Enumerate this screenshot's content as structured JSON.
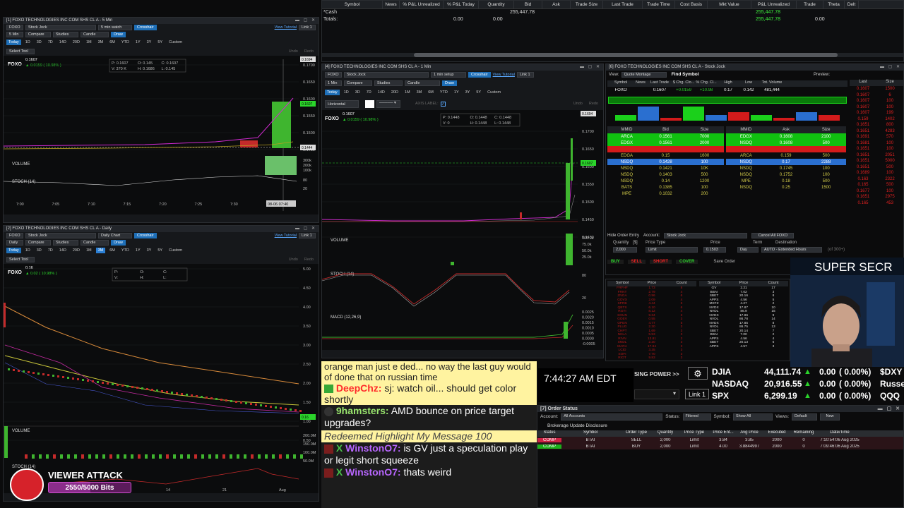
{
  "portfolio": {
    "columns": [
      "Symbol",
      "News",
      "% P&L Unrealized",
      "% P&L Today",
      "Quantity",
      "Bid",
      "Ask",
      "Trade Size",
      "Last Trade",
      "Trade Time",
      "Cost Basis",
      "Mkt Value",
      "P&L Unrealized",
      "Trade",
      "Theta",
      "Delt"
    ],
    "cash_label": "*Cash",
    "totals_label": "Totals:",
    "cash_quantity": "255,447.78",
    "cash_mkt_value": "255,447.78",
    "totals_unreal": "0.00",
    "totals_today": "0.00",
    "totals_mkt_value": "255,447.78",
    "totals_pl": "0.00"
  },
  "chart1": {
    "title": "[1] FOXO TECHNOLOGIES INC COM SHS CL A - 5 Min",
    "symbol": "FOXO",
    "layout": "Stock Jock",
    "setup": "5 min watch",
    "interval": "5 Min",
    "crosshair": "Crosshair",
    "tutorial": "View Tutorial",
    "link": "Link 1",
    "compare": "Compare",
    "studies": "Studies",
    "candle": "Candle",
    "draw": "Draw",
    "timeframes": [
      "Today",
      "1D",
      "3D",
      "7D",
      "14D",
      "20D",
      "1M",
      "3M",
      "6M",
      "YTD",
      "1Y",
      "3Y",
      "5Y",
      "Custom"
    ],
    "select_tool": "Select Tool",
    "undo": "Undo",
    "redo": "Redo",
    "price": "0.1607",
    "change": "0.0159 ( 10.98% )",
    "ohlc_p": "P: 0.1607",
    "ohlc_o": "O: 0.145",
    "ohlc_c": "C: 0.1607",
    "ohlc_v": "V: 370 K",
    "ohlc_h": "H: 0.1686",
    "ohlc_l": "L: 0.145",
    "volume_label": "VOLUME",
    "stoch_label": "STOCH (14)",
    "time_labels": [
      "7:00",
      "7:05",
      "7:10",
      "7:15",
      "7:20",
      "7:25",
      "7:30",
      "7:35"
    ],
    "current_time": "08-06 07:40",
    "y_labels": [
      "0.1700",
      "0.1650",
      "0.1600",
      "0.1550",
      "0.1500",
      "0.1450"
    ],
    "badge_price": "0.1607",
    "badge_top": "0.1694",
    "badge_low": "0.1444",
    "vol_labels": [
      "300k",
      "200k",
      "100k"
    ],
    "stoch_labels": [
      "80",
      "20"
    ]
  },
  "chart2": {
    "title": "[2] FOXO TECHNOLOGIES INC COM SHS CL A - Daily",
    "setup": "Daily Chart",
    "interval": "Daily",
    "symbol": "FOXO",
    "price": "0.16",
    "change": "0.02 ( 10.98% )",
    "ohlc_p": "P:",
    "ohlc_o": "O:",
    "ohlc_c": "C:",
    "ohlc_v": "V:",
    "ohlc_h": "H:",
    "ohlc_l": "L:",
    "volume_label": "VOLUME",
    "stoch_label": "STOCH (14)",
    "y_labels": [
      "5.00",
      "4.50",
      "4.00",
      "3.50",
      "3.00",
      "2.50",
      "2.00",
      "1.50",
      "1.00",
      "0.50"
    ],
    "vol_labels": [
      "200.0M",
      "150.0M",
      "100.0M",
      "50.0M"
    ],
    "time_labels": [
      "Jul",
      "14",
      "21",
      "Aug"
    ],
    "badge_price": "0.16"
  },
  "chart3": {
    "title": "[4] FOXO TECHNOLOGIES INC COM SHS CL A - 1 Min",
    "setup": "1 min setup",
    "interval": "1 Min",
    "horizontal": "Horizontal",
    "axis_label": "AXIS LABEL:",
    "price": "0.1607",
    "change": "0.0159 ( 10.98% )",
    "ohlc_p": "P: 0.1448",
    "ohlc_o": "O: 0.1448",
    "ohlc_c": "C: 0.1448",
    "ohlc_v": "V: 0",
    "ohlc_h": "H: 0.1448",
    "ohlc_l": "L: 0.1448",
    "volume_label": "VOLUME",
    "stoch_label": "STOCH (14)",
    "macd_label": "MACD (12,26,9)",
    "y_labels": [
      "0.1700",
      "0.1650",
      "0.1600",
      "0.1550",
      "0.1500",
      "0.1450",
      "0.1400"
    ],
    "vol_labels": [
      "100.0k",
      "75.0k",
      "50.0k",
      "25.0k"
    ],
    "stoch_labels": [
      "80",
      "20"
    ],
    "macd_labels": [
      "0.0025",
      "0.0020",
      "0.0015",
      "0.0010",
      "0.0005",
      "0.0000",
      "-0.0005"
    ],
    "badge_price": "0.1607",
    "badge_top": "0.1694"
  },
  "level2": {
    "title": "[6] FOXO TECHNOLOGIES INC COM SHS CL A - Stock Jock",
    "view_label": "View:",
    "view_value": "Quote Montage",
    "find_symbol": "Find Symbol",
    "preview_label": "Preview:",
    "preview_value": "OFF",
    "quote_headers": [
      "Symbol",
      "News",
      "Last Trade",
      "$ Chg. Clo...",
      "% Chg. Cl...",
      "High",
      "Low",
      "Tot. Volume"
    ],
    "quote_values": [
      "FOXO",
      "",
      "0.1607",
      "+0.0159",
      "+10.98",
      "0.17",
      "0.142",
      "481,444"
    ],
    "bid_headers": [
      "MMID",
      "Bid",
      "Size"
    ],
    "ask_headers": [
      "MMID",
      "Ask",
      "Size"
    ],
    "bids": [
      {
        "mmid": "ARCA",
        "price": "0.1561",
        "size": "7000",
        "c": "#10c010"
      },
      {
        "mmid": "EDGX",
        "price": "0.1561",
        "size": "2000",
        "c": "#10c010"
      },
      {
        "mmid": "",
        "price": "",
        "size": "",
        "c": "#d31b1b"
      },
      {
        "mmid": "EDGA",
        "price": "0.15",
        "size": "1600",
        "c": "#0b0b0c"
      },
      {
        "mmid": "NSDQ",
        "price": "0.1428",
        "size": "100",
        "c": "#2a6fd0"
      },
      {
        "mmid": "NSDQ",
        "price": "0.1421",
        "size": "10K",
        "c": "#0b0b0c"
      },
      {
        "mmid": "NSDQ",
        "price": "0.1403",
        "size": "500",
        "c": "#0b0b0c"
      },
      {
        "mmid": "NSDQ",
        "price": "0.14",
        "size": "1200",
        "c": "#0b0b0c"
      },
      {
        "mmid": "BATS",
        "price": "0.1385",
        "size": "100",
        "c": "#0b0b0c"
      },
      {
        "mmid": "MPE",
        "price": "0.1032",
        "size": "200",
        "c": "#0b0b0c"
      }
    ],
    "asks": [
      {
        "mmid": "EDGX",
        "price": "0.1608",
        "size": "2100",
        "c": "#10c010"
      },
      {
        "mmid": "NSDQ",
        "price": "0.1608",
        "size": "500",
        "c": "#10c010"
      },
      {
        "mmid": "",
        "price": "",
        "size": "",
        "c": "#d31b1b"
      },
      {
        "mmid": "ARCA",
        "price": "0.159",
        "size": "500",
        "c": "#0b0b0c"
      },
      {
        "mmid": "NSDQ",
        "price": "0.17",
        "size": "2288",
        "c": "#2a6fd0"
      },
      {
        "mmid": "NSDQ",
        "price": "0.1745",
        "size": "100",
        "c": "#0b0b0c"
      },
      {
        "mmid": "NSDQ",
        "price": "0.1752",
        "size": "100",
        "c": "#0b0b0c"
      },
      {
        "mmid": "MPE",
        "price": "0.18",
        "size": "500",
        "c": "#0b0b0c"
      },
      {
        "mmid": "NSDQ",
        "price": "0.25",
        "size": "1500",
        "c": "#0b0b0c"
      }
    ],
    "ts_headers": [
      "Last",
      "Size"
    ],
    "time_sales": [
      [
        "0.1607",
        "1500"
      ],
      [
        "0.1607",
        "6"
      ],
      [
        "0.1607",
        "100"
      ],
      [
        "0.1607",
        "100"
      ],
      [
        "0.1607",
        "199"
      ],
      [
        "0.159",
        "1402"
      ],
      [
        "0.1651",
        "800"
      ],
      [
        "0.1651",
        "4283"
      ],
      [
        "0.1691",
        "570"
      ],
      [
        "0.1681",
        "100"
      ],
      [
        "0.1651",
        "100"
      ],
      [
        "0.1651",
        "2051"
      ],
      [
        "0.1651",
        "5000"
      ],
      [
        "0.1651",
        "500"
      ],
      [
        "0.1689",
        "100"
      ],
      [
        "0.163",
        "2322"
      ],
      [
        "0.165",
        "500"
      ],
      [
        "0.1677",
        "100"
      ],
      [
        "0.1651",
        "2975"
      ],
      [
        "0.165",
        "453"
      ]
    ],
    "hide_order_entry": "Hide Order Entry",
    "account_label": "Account:",
    "account_value": "Stock Jock",
    "cancel_all": "Cancel All FOXO",
    "qty_label": "Quantity",
    "qty_unit": "[$]",
    "qty_value": "2,000",
    "price_type_label": "Price Type",
    "price_type_value": "Limit",
    "price_label": "Price",
    "price_value": "0.1503",
    "term_label": "Term",
    "term_value": "Day",
    "dest_label": "Destination",
    "dest_value": "AUTO - Extended Hours",
    "aon": "AON",
    "of_label": "(of 300+)",
    "buy": "BUY",
    "sell": "SELL",
    "short": "SHORT",
    "cover": "COVER",
    "save_order": "Save Order",
    "reserve": "Reserve"
  },
  "scanner": {
    "left_headers": [
      "Symbol",
      "Price",
      "Count"
    ],
    "left_rows": [
      [
        "FRFHF",
        "1.73",
        "8"
      ],
      [
        "FRNT",
        "2.79",
        "4"
      ],
      [
        "ZNGA",
        "0.96",
        "6"
      ],
      [
        "GOVX",
        "2.09",
        "4"
      ],
      [
        "SPRB",
        "4.44",
        "6"
      ],
      [
        "QBTS",
        "6.10",
        "6"
      ],
      [
        "RGTI",
        "8.12",
        "4"
      ],
      [
        "SOUN",
        "9.34",
        "3"
      ],
      [
        "GOEV",
        "0.55",
        "3"
      ],
      [
        "OPEN",
        "4.77",
        "5"
      ],
      [
        "PLUG",
        "2.30",
        "3"
      ],
      [
        "CHPT",
        "1.69",
        "3"
      ],
      [
        "NKLA",
        "5.53",
        "3"
      ],
      [
        "RIVN",
        "13.81",
        "3"
      ],
      [
        "SNDL",
        "2.20",
        "3"
      ],
      [
        "MARA",
        "17.94",
        "3"
      ],
      [
        "LCID",
        "3.35",
        "3"
      ],
      [
        "SOFI",
        "7.70",
        "3"
      ],
      [
        "RIOT",
        "9.83",
        "3"
      ],
      [
        "HUT",
        "14.80",
        "3"
      ],
      [
        "CLSK",
        "11.10",
        "3"
      ]
    ],
    "right_headers": [
      "Symbol",
      "Price",
      "Count"
    ],
    "right_rows": [
      [
        "GV",
        "2.21",
        "17"
      ],
      [
        "BBAI",
        "7.02",
        "3"
      ],
      [
        "SBET",
        "20.16",
        "8"
      ],
      [
        "APPS",
        "4.56",
        "5"
      ],
      [
        "MSTZ",
        "4.27",
        "2"
      ],
      [
        "NVDX",
        "17.87",
        "10"
      ],
      [
        "NVDL",
        "86.9",
        "15"
      ],
      [
        "NVDX",
        "17.86",
        "9"
      ],
      [
        "NVDL",
        "86.78",
        "14"
      ],
      [
        "NVDX",
        "17.85",
        "8"
      ],
      [
        "NVDL",
        "86.75",
        "13"
      ],
      [
        "SBET",
        "20.14",
        "7"
      ],
      [
        "BBAI",
        "7.00",
        "2"
      ],
      [
        "APPS",
        "4.56",
        "4"
      ],
      [
        "SBET",
        "20.13",
        "6"
      ],
      [
        "APPS",
        "4.57",
        "3"
      ]
    ]
  },
  "webcam_text": "SUPER SECR",
  "chat": {
    "lines": [
      {
        "user": "",
        "msg": "orange man just e ded... no way the last guy would of done that on russian time",
        "uc": "#fff"
      },
      {
        "user": "DeepChz:",
        "msg": "sj: watch oil... should get color shortly",
        "uc": "#ff2a2a"
      },
      {
        "user": "9hamsters:",
        "msg": "AMD bounce on price target upgrades?",
        "uc": "#9ae66e"
      },
      {
        "user": "",
        "msg": "Redeemed Highlight My Message  100",
        "uc": "#fff"
      },
      {
        "user": "WinstonO7:",
        "msg": "is GV just a speculation play or legit short squeeze",
        "uc": "#b866ff"
      },
      {
        "user": "WinstonO7:",
        "msg": "thats weird",
        "uc": "#b866ff"
      }
    ]
  },
  "viewer_attack": {
    "title": "VIEWER ATTACK",
    "progress": "2550/5000 Bits",
    "fraction": 0.51
  },
  "clock": "7:44:27 AM EDT",
  "buying_power": "SING POWER >>",
  "link1": "Link 1",
  "index": [
    {
      "name": "DJIA",
      "value": "44,111.74",
      "chg": "0.00",
      "pct": "( 0.00%)",
      "next": "$DXY"
    },
    {
      "name": "NASDAQ",
      "value": "20,916.55",
      "chg": "0.00",
      "pct": "( 0.00%)",
      "next": "Russel"
    },
    {
      "name": "SPX",
      "value": "6,299.19",
      "chg": "0.00",
      "pct": "( 0.00%)",
      "next": "QQQ"
    }
  ],
  "orders": {
    "title": "[7] Order Status",
    "account_label": "Account:",
    "account_value": "All Accounts",
    "status_label": "Status:",
    "status_value": "Filtered",
    "symbol_label": "Symbol:",
    "symbol_value": "Show All",
    "views_label": "Views:",
    "views_value": "Default",
    "new": "New",
    "disclosure": "Brokerage Update Disclosure",
    "headers": [
      "Status",
      "Symbol",
      "Order Type",
      "Quantity",
      "Price Type",
      "Price Ent...",
      "Avg Price",
      "Executed",
      "Remaining",
      "Date/Time"
    ],
    "rows": [
      [
        "COMP",
        "BTAI",
        "SELL",
        "2,000",
        "Limit",
        "3.84",
        "3.85",
        "2000",
        "0",
        "7:10:54:06 Aug 2025"
      ],
      [
        "COMP",
        "BTAI",
        "BUY",
        "2,000",
        "Limit",
        "4.00",
        "3.8844997",
        "2000",
        "0",
        "7:09:46:06 Aug 2025"
      ]
    ]
  }
}
